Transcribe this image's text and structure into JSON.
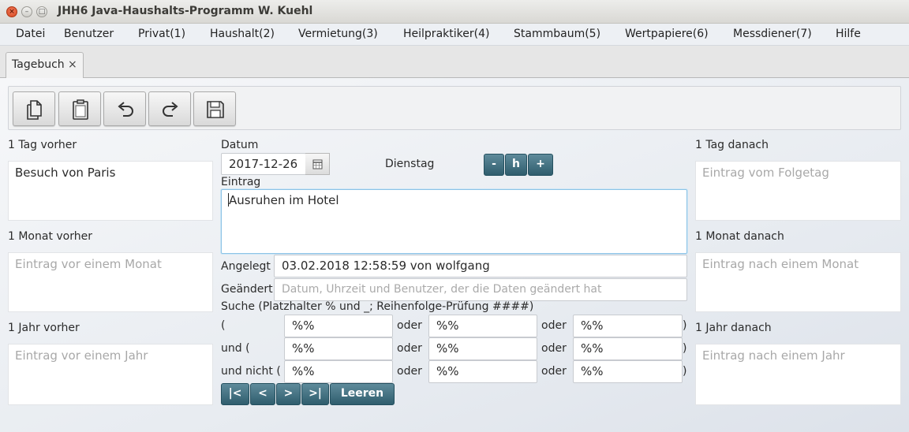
{
  "window": {
    "title": "JHH6 Java-Haushalts-Programm W. Kuehl",
    "close_glyph": "×",
    "min_glyph": "–",
    "max_glyph": "□"
  },
  "menu": {
    "items": [
      {
        "label": "Datei"
      },
      {
        "label": "Benutzer"
      },
      {
        "label": "Privat(1)"
      },
      {
        "label": "Haushalt(2)"
      },
      {
        "label": "Vermietung(3)"
      },
      {
        "label": "Heilpraktiker(4)"
      },
      {
        "label": "Stammbaum(5)"
      },
      {
        "label": "Wertpapiere(6)"
      },
      {
        "label": "Messdiener(7)"
      },
      {
        "label": "Hilfe"
      }
    ]
  },
  "tabs": [
    {
      "label": "Tagebuch",
      "close": "×"
    }
  ],
  "toolbar": {
    "buttons": [
      {
        "icon": "copy-icon"
      },
      {
        "icon": "paste-icon"
      },
      {
        "icon": "undo-icon"
      },
      {
        "icon": "redo-icon"
      },
      {
        "icon": "save-icon"
      }
    ]
  },
  "left": {
    "day_before_label": "1 Tag vorher",
    "day_before_value": "Besuch von Paris",
    "month_before_label": "1 Monat vorher",
    "month_before_placeholder": "Eintrag vor einem Monat",
    "year_before_label": "1 Jahr vorher",
    "year_before_placeholder": "Eintrag vor einem Jahr"
  },
  "right": {
    "day_after_label": "1 Tag danach",
    "day_after_placeholder": "Eintrag vom Folgetag",
    "month_after_label": "1 Monat danach",
    "month_after_placeholder": "Eintrag nach einem Monat",
    "year_after_label": "1 Jahr danach",
    "year_after_placeholder": "Eintrag nach einem Jahr"
  },
  "center": {
    "date_label": "Datum",
    "date_value": "2017-12-26",
    "weekday": "Dienstag",
    "btn_minus": "-",
    "btn_h": "h",
    "btn_plus": "+",
    "entry_label": "Eintrag",
    "entry_value": "Ausruhen im Hotel",
    "created_label": "Angelegt",
    "created_value": "03.02.2018 12:58:59 von wolfgang",
    "changed_label": "Geändert",
    "changed_placeholder": "Datum, Uhrzeit und Benutzer, der die Daten geändert hat"
  },
  "search": {
    "label": "Suche (Platzhalter % und _; Reihenfolge-Prüfung ####)",
    "rows": [
      {
        "prefix": "(",
        "v1": "%%",
        "or1": "oder",
        "v2": "%%",
        "or2": "oder",
        "v3": "%%",
        "suffix": ")"
      },
      {
        "prefix": "und (",
        "v1": "%%",
        "or1": "oder",
        "v2": "%%",
        "or2": "oder",
        "v3": "%%",
        "suffix": ")"
      },
      {
        "prefix": "und nicht (",
        "v1": "%%",
        "or1": "oder",
        "v2": "%%",
        "or2": "oder",
        "v3": "%%",
        "suffix": ")"
      }
    ],
    "nav": {
      "first": "|<",
      "prev": "<",
      "next": ">",
      "last": ">|",
      "clear": "Leeren"
    }
  },
  "colors": {
    "teal_button": "#3d6b7b",
    "focus_border": "#8cc3e6",
    "close_button": "#e05a33"
  }
}
